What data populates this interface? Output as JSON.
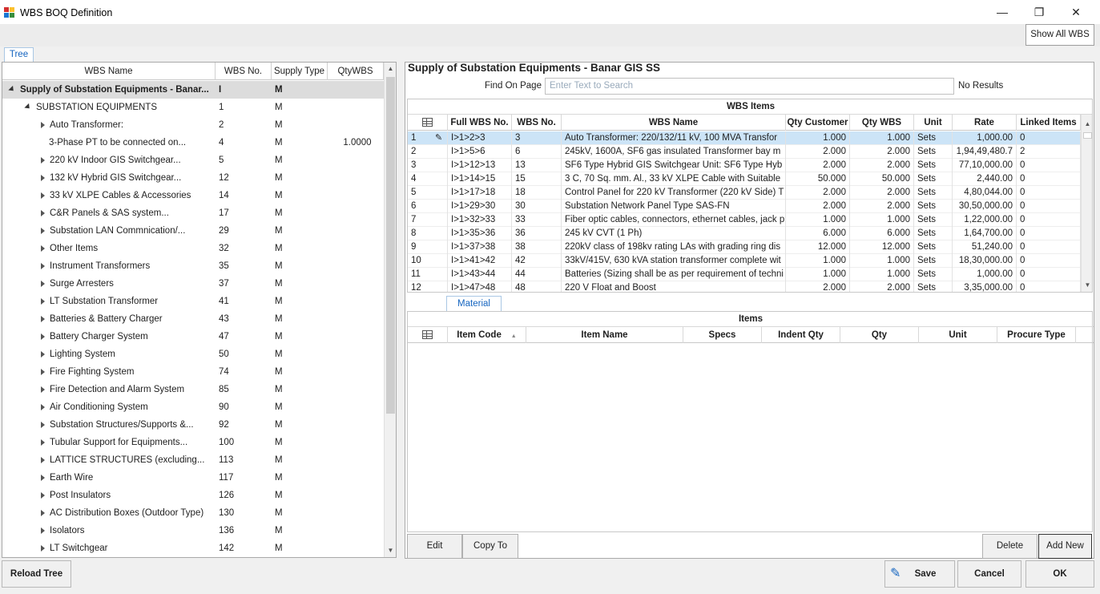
{
  "window": {
    "title": "WBS BOQ Definition",
    "minimize": "—",
    "restore": "❐",
    "close": "✕"
  },
  "toolbar": {
    "show_all_wbs": "Show All WBS"
  },
  "left": {
    "tab": "Tree",
    "headers": {
      "name": "WBS Name",
      "no": "WBS No.",
      "supply": "Supply Type",
      "qty": "QtyWBS"
    },
    "rows": [
      {
        "name": "Supply of Substation Equipments - Banar...",
        "no": "I",
        "supply": "M",
        "qty": "",
        "level": 0,
        "expander": "down",
        "selected": true
      },
      {
        "name": "SUBSTATION EQUIPMENTS",
        "no": "1",
        "supply": "M",
        "qty": "",
        "level": 1,
        "expander": "down"
      },
      {
        "name": "Auto Transformer:",
        "no": "2",
        "supply": "M",
        "qty": "",
        "level": 2,
        "expander": "right"
      },
      {
        "name": "3-Phase PT to be connected on...",
        "no": "4",
        "supply": "M",
        "qty": "1.0000",
        "level": 2,
        "expander": "none"
      },
      {
        "name": "220 kV Indoor GIS Switchgear...",
        "no": "5",
        "supply": "M",
        "qty": "",
        "level": 2,
        "expander": "right"
      },
      {
        "name": "132 kV Hybrid GIS Switchgear...",
        "no": "12",
        "supply": "M",
        "qty": "",
        "level": 2,
        "expander": "right"
      },
      {
        "name": "33 kV XLPE Cables & Accessories",
        "no": "14",
        "supply": "M",
        "qty": "",
        "level": 2,
        "expander": "right"
      },
      {
        "name": "C&R Panels & SAS system...",
        "no": "17",
        "supply": "M",
        "qty": "",
        "level": 2,
        "expander": "right"
      },
      {
        "name": "Substation LAN Commnication/...",
        "no": "29",
        "supply": "M",
        "qty": "",
        "level": 2,
        "expander": "right"
      },
      {
        "name": "Other Items",
        "no": "32",
        "supply": "M",
        "qty": "",
        "level": 2,
        "expander": "right"
      },
      {
        "name": "Instrument Transformers",
        "no": "35",
        "supply": "M",
        "qty": "",
        "level": 2,
        "expander": "right"
      },
      {
        "name": "Surge Arresters",
        "no": "37",
        "supply": "M",
        "qty": "",
        "level": 2,
        "expander": "right"
      },
      {
        "name": "LT Substation Transformer",
        "no": "41",
        "supply": "M",
        "qty": "",
        "level": 2,
        "expander": "right"
      },
      {
        "name": "Batteries & Battery Charger",
        "no": "43",
        "supply": "M",
        "qty": "",
        "level": 2,
        "expander": "right"
      },
      {
        "name": "Battery Charger System",
        "no": "47",
        "supply": "M",
        "qty": "",
        "level": 2,
        "expander": "right"
      },
      {
        "name": "Lighting System",
        "no": "50",
        "supply": "M",
        "qty": "",
        "level": 2,
        "expander": "right"
      },
      {
        "name": "Fire Fighting System",
        "no": "74",
        "supply": "M",
        "qty": "",
        "level": 2,
        "expander": "right"
      },
      {
        "name": "Fire Detection and Alarm System",
        "no": "85",
        "supply": "M",
        "qty": "",
        "level": 2,
        "expander": "right"
      },
      {
        "name": "Air Conditioning System",
        "no": "90",
        "supply": "M",
        "qty": "",
        "level": 2,
        "expander": "right"
      },
      {
        "name": "Substation Structures/Supports &...",
        "no": "92",
        "supply": "M",
        "qty": "",
        "level": 2,
        "expander": "right"
      },
      {
        "name": "Tubular Support for Equipments...",
        "no": "100",
        "supply": "M",
        "qty": "",
        "level": 2,
        "expander": "right"
      },
      {
        "name": "LATTICE STRUCTURES (excluding...",
        "no": "113",
        "supply": "M",
        "qty": "",
        "level": 2,
        "expander": "right"
      },
      {
        "name": "Earth Wire",
        "no": "117",
        "supply": "M",
        "qty": "",
        "level": 2,
        "expander": "right"
      },
      {
        "name": "Post Insulators",
        "no": "126",
        "supply": "M",
        "qty": "",
        "level": 2,
        "expander": "right"
      },
      {
        "name": "AC Distribution Boxes (Outdoor Type)",
        "no": "130",
        "supply": "M",
        "qty": "",
        "level": 2,
        "expander": "right"
      },
      {
        "name": "Isolators",
        "no": "136",
        "supply": "M",
        "qty": "",
        "level": 2,
        "expander": "right"
      },
      {
        "name": "LT Switchgear",
        "no": "142",
        "supply": "M",
        "qty": "",
        "level": 2,
        "expander": "right"
      }
    ]
  },
  "right": {
    "title": "Supply of Substation Equipments - Banar GIS SS",
    "find_label": "Find On Page",
    "find_placeholder": "Enter Text to Search",
    "find_status": "No Results",
    "wbs_items": {
      "band": "WBS Items",
      "headers": [
        "",
        "Full WBS No.",
        "WBS No.",
        "WBS Name",
        "Qty Customer",
        "Qty WBS",
        "Unit",
        "Rate",
        "Linked Items"
      ],
      "rows": [
        [
          "1",
          "I>1>2>3",
          "3",
          "Auto Transformer: 220/132/11 kV, 100 MVA Transfor",
          "1.000",
          "1.000",
          "Sets",
          "1,000.00",
          "0"
        ],
        [
          "2",
          "I>1>5>6",
          "6",
          "245kV, 1600A, SF6 gas insulated Transformer bay m",
          "2.000",
          "2.000",
          "Sets",
          "1,94,49,480.7",
          "2"
        ],
        [
          "3",
          "I>1>12>13",
          "13",
          "SF6 Type Hybrid GIS Switchgear Unit: SF6 Type Hyb",
          "2.000",
          "2.000",
          "Sets",
          "77,10,000.00",
          "0"
        ],
        [
          "4",
          "I>1>14>15",
          "15",
          "3 C, 70 Sq. mm. Al., 33 kV XLPE Cable with Suitable",
          "50.000",
          "50.000",
          "Sets",
          "2,440.00",
          "0"
        ],
        [
          "5",
          "I>1>17>18",
          "18",
          "Control Panel for 220 kV Transformer (220 kV Side) T",
          "2.000",
          "2.000",
          "Sets",
          "4,80,044.00",
          "0"
        ],
        [
          "6",
          "I>1>29>30",
          "30",
          "Substation Network Panel Type SAS-FN",
          "2.000",
          "2.000",
          "Sets",
          "30,50,000.00",
          "0"
        ],
        [
          "7",
          "I>1>32>33",
          "33",
          "Fiber optic cables, connectors, ethernet cables, jack p",
          "1.000",
          "1.000",
          "Sets",
          "1,22,000.00",
          "0"
        ],
        [
          "8",
          "I>1>35>36",
          "36",
          "245 kV CVT (1 Ph)",
          "6.000",
          "6.000",
          "Sets",
          "1,64,700.00",
          "0"
        ],
        [
          "9",
          "I>1>37>38",
          "38",
          "220kV class of 198kv rating LAs with grading ring dis",
          "12.000",
          "12.000",
          "Sets",
          "51,240.00",
          "0"
        ],
        [
          "10",
          "I>1>41>42",
          "42",
          "33kV/415V, 630 kVA station transformer complete wit",
          "1.000",
          "1.000",
          "Sets",
          "18,30,000.00",
          "0"
        ],
        [
          "11",
          "I>1>43>44",
          "44",
          "Batteries (Sizing shall be as per requirement of techni",
          "1.000",
          "1.000",
          "Sets",
          "1,000.00",
          "0"
        ],
        [
          "12",
          "I>1>47>48",
          "48",
          "220 V Float and Boost",
          "2.000",
          "2.000",
          "Sets",
          "3,35,000.00",
          "0"
        ]
      ]
    },
    "material_tab": "Material",
    "items": {
      "band": "Items",
      "headers": [
        "",
        "Item Code",
        "Item Name",
        "Specs",
        "Indent Qty",
        "Qty",
        "Unit",
        "Procure Type"
      ]
    },
    "buttons": {
      "edit": "Edit",
      "copy_to": "Copy To",
      "delete": "Delete",
      "add_new": "Add New"
    }
  },
  "footer": {
    "reload": "Reload Tree",
    "save": "Save",
    "cancel": "Cancel",
    "ok": "OK"
  },
  "colors": {
    "accent": "#1565c0",
    "selected_row": "#cce4f7",
    "tree_selected": "#dcdcdc"
  }
}
